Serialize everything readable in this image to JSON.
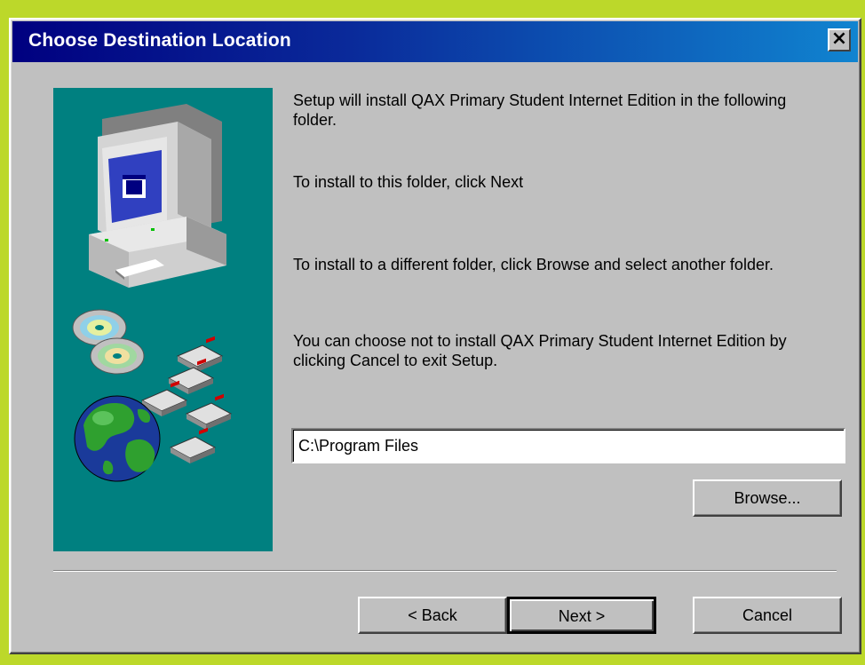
{
  "window": {
    "title": "Choose Destination Location",
    "close_symbol": "×"
  },
  "messages": [
    "Setup will install QAX Primary Student Internet Edition in the following folder.",
    "To install to this folder, click Next",
    "To install to a different folder, click Browse and select another folder.",
    "You can choose not to install QAX Primary Student Internet Edition by clicking Cancel to exit Setup."
  ],
  "destination": {
    "value": "C:\\Program Files"
  },
  "buttons": {
    "browse": "Browse...",
    "back": "< Back",
    "next": "Next >",
    "cancel": "Cancel"
  },
  "illustration": {
    "icons": [
      "computer-icon",
      "cd-icon",
      "floppy-disk-icon",
      "globe-icon"
    ]
  },
  "colors": {
    "panel": "#008080",
    "title_start": "#000080",
    "title_end": "#1084d0",
    "face": "#c0c0c0"
  }
}
